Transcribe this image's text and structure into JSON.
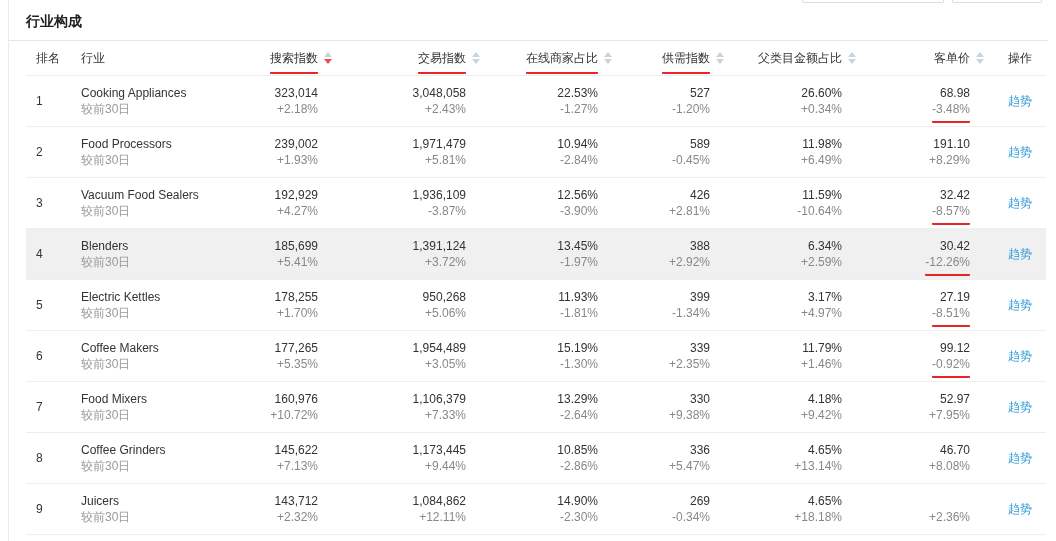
{
  "title": "行业构成",
  "columns": [
    {
      "label": "排名",
      "kind": "plain"
    },
    {
      "label": "行业",
      "kind": "plain"
    },
    {
      "label": "搜索指数",
      "kind": "number",
      "sorted": true,
      "marked": true
    },
    {
      "label": "交易指数",
      "kind": "number",
      "sorted": false,
      "marked": true
    },
    {
      "label": "在线商家占比",
      "kind": "number",
      "sorted": false,
      "marked": true
    },
    {
      "label": "供需指数",
      "kind": "number",
      "sorted": false,
      "marked": true
    },
    {
      "label": "父类目金额占比",
      "kind": "number",
      "sorted": false,
      "marked": false
    },
    {
      "label": "客单价",
      "kind": "number",
      "sorted": false,
      "marked": false
    },
    {
      "label": "操作",
      "kind": "plain"
    }
  ],
  "rows": [
    {
      "rank": "1",
      "name": "Cooking Appliances",
      "compare": "较前30日",
      "highlighted": false,
      "action": "趋势",
      "cells": [
        {
          "value": "323,014",
          "change": "+2.18%",
          "marked": false
        },
        {
          "value": "3,048,058",
          "change": "+2.43%",
          "marked": false
        },
        {
          "value": "22.53%",
          "change": "-1.27%",
          "marked": false
        },
        {
          "value": "527",
          "change": "-1.20%",
          "marked": false
        },
        {
          "value": "26.60%",
          "change": "+0.34%",
          "marked": false
        },
        {
          "value": "68.98",
          "change": "-3.48%",
          "marked": true
        }
      ]
    },
    {
      "rank": "2",
      "name": "Food Processors",
      "compare": "较前30日",
      "highlighted": false,
      "action": "趋势",
      "cells": [
        {
          "value": "239,002",
          "change": "+1.93%",
          "marked": false
        },
        {
          "value": "1,971,479",
          "change": "+5.81%",
          "marked": false
        },
        {
          "value": "10.94%",
          "change": "-2.84%",
          "marked": false
        },
        {
          "value": "589",
          "change": "-0.45%",
          "marked": false
        },
        {
          "value": "11.98%",
          "change": "+6.49%",
          "marked": false
        },
        {
          "value": "191.10",
          "change": "+8.29%",
          "marked": false
        }
      ]
    },
    {
      "rank": "3",
      "name": "Vacuum Food Sealers",
      "compare": "较前30日",
      "highlighted": false,
      "action": "趋势",
      "cells": [
        {
          "value": "192,929",
          "change": "+4.27%",
          "marked": false
        },
        {
          "value": "1,936,109",
          "change": "-3.87%",
          "marked": false
        },
        {
          "value": "12.56%",
          "change": "-3.90%",
          "marked": false
        },
        {
          "value": "426",
          "change": "+2.81%",
          "marked": false
        },
        {
          "value": "11.59%",
          "change": "-10.64%",
          "marked": false
        },
        {
          "value": "32.42",
          "change": "-8.57%",
          "marked": true
        }
      ]
    },
    {
      "rank": "4",
      "name": "Blenders",
      "compare": "较前30日",
      "highlighted": true,
      "action": "趋势",
      "cells": [
        {
          "value": "185,699",
          "change": "+5.41%",
          "marked": false
        },
        {
          "value": "1,391,124",
          "change": "+3.72%",
          "marked": false
        },
        {
          "value": "13.45%",
          "change": "-1.97%",
          "marked": false
        },
        {
          "value": "388",
          "change": "+2.92%",
          "marked": false
        },
        {
          "value": "6.34%",
          "change": "+2.59%",
          "marked": false
        },
        {
          "value": "30.42",
          "change": "-12.26%",
          "marked": true
        }
      ]
    },
    {
      "rank": "5",
      "name": "Electric Kettles",
      "compare": "较前30日",
      "highlighted": false,
      "action": "趋势",
      "cells": [
        {
          "value": "178,255",
          "change": "+1.70%",
          "marked": false
        },
        {
          "value": "950,268",
          "change": "+5.06%",
          "marked": false
        },
        {
          "value": "11.93%",
          "change": "-1.81%",
          "marked": false
        },
        {
          "value": "399",
          "change": "-1.34%",
          "marked": false
        },
        {
          "value": "3.17%",
          "change": "+4.97%",
          "marked": false
        },
        {
          "value": "27.19",
          "change": "-8.51%",
          "marked": true
        }
      ]
    },
    {
      "rank": "6",
      "name": "Coffee Makers",
      "compare": "较前30日",
      "highlighted": false,
      "action": "趋势",
      "cells": [
        {
          "value": "177,265",
          "change": "+5.35%",
          "marked": false
        },
        {
          "value": "1,954,489",
          "change": "+3.05%",
          "marked": false
        },
        {
          "value": "15.19%",
          "change": "-1.30%",
          "marked": false
        },
        {
          "value": "339",
          "change": "+2.35%",
          "marked": false
        },
        {
          "value": "11.79%",
          "change": "+1.46%",
          "marked": false
        },
        {
          "value": "99.12",
          "change": "-0.92%",
          "marked": true
        }
      ]
    },
    {
      "rank": "7",
      "name": "Food Mixers",
      "compare": "较前30日",
      "highlighted": false,
      "action": "趋势",
      "cells": [
        {
          "value": "160,976",
          "change": "+10.72%",
          "marked": false
        },
        {
          "value": "1,106,379",
          "change": "+7.33%",
          "marked": false
        },
        {
          "value": "13.29%",
          "change": "-2.64%",
          "marked": false
        },
        {
          "value": "330",
          "change": "+9.38%",
          "marked": false
        },
        {
          "value": "4.18%",
          "change": "+9.42%",
          "marked": false
        },
        {
          "value": "52.97",
          "change": "+7.95%",
          "marked": false
        }
      ]
    },
    {
      "rank": "8",
      "name": "Coffee Grinders",
      "compare": "较前30日",
      "highlighted": false,
      "action": "趋势",
      "cells": [
        {
          "value": "145,622",
          "change": "+7.13%",
          "marked": false
        },
        {
          "value": "1,173,445",
          "change": "+9.44%",
          "marked": false
        },
        {
          "value": "10.85%",
          "change": "-2.86%",
          "marked": false
        },
        {
          "value": "336",
          "change": "+5.47%",
          "marked": false
        },
        {
          "value": "4.65%",
          "change": "+13.14%",
          "marked": false
        },
        {
          "value": "46.70",
          "change": "+8.08%",
          "marked": false
        }
      ]
    },
    {
      "rank": "9",
      "name": "Juicers",
      "compare": "较前30日",
      "highlighted": false,
      "action": "趋势",
      "cells": [
        {
          "value": "143,712",
          "change": "+2.32%",
          "marked": false
        },
        {
          "value": "1,084,862",
          "change": "+12.11%",
          "marked": false
        },
        {
          "value": "14.90%",
          "change": "-2.30%",
          "marked": false
        },
        {
          "value": "269",
          "change": "-0.34%",
          "marked": false
        },
        {
          "value": "4.65%",
          "change": "+18.18%",
          "marked": false
        },
        {
          "change": "+2.36%",
          "marked": false
        }
      ]
    }
  ]
}
